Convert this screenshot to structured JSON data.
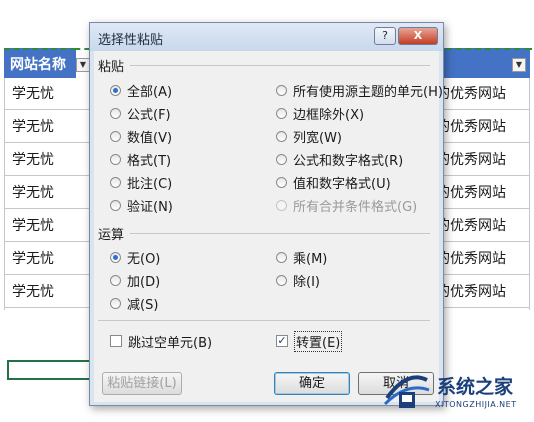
{
  "sheet": {
    "header_left": "网站名称",
    "rows_left": [
      "学无忧",
      "学无忧",
      "学无忧",
      "学无忧",
      "学无忧",
      "学无忧",
      "学无忧"
    ],
    "rows_right": [
      "的优秀网站",
      "的优秀网站",
      "的优秀网站",
      "的优秀网站",
      "的优秀网站",
      "的优秀网站",
      "的优秀网站"
    ],
    "header_color": "#4472c4"
  },
  "dialog": {
    "title": "选择性粘贴",
    "help_label": "?",
    "close_label": "X",
    "paste_section": "粘贴",
    "paste_options_left": [
      {
        "label": "全部(A)",
        "checked": true
      },
      {
        "label": "公式(F)",
        "checked": false
      },
      {
        "label": "数值(V)",
        "checked": false
      },
      {
        "label": "格式(T)",
        "checked": false
      },
      {
        "label": "批注(C)",
        "checked": false
      },
      {
        "label": "验证(N)",
        "checked": false
      }
    ],
    "paste_options_right": [
      {
        "label": "所有使用源主题的单元(H)",
        "checked": false,
        "disabled": false
      },
      {
        "label": "边框除外(X)",
        "checked": false,
        "disabled": false
      },
      {
        "label": "列宽(W)",
        "checked": false,
        "disabled": false
      },
      {
        "label": "公式和数字格式(R)",
        "checked": false,
        "disabled": false
      },
      {
        "label": "值和数字格式(U)",
        "checked": false,
        "disabled": false
      },
      {
        "label": "所有合并条件格式(G)",
        "checked": false,
        "disabled": true
      }
    ],
    "operation_section": "运算",
    "operation_options_left": [
      {
        "label": "无(O)",
        "checked": true
      },
      {
        "label": "加(D)",
        "checked": false
      },
      {
        "label": "减(S)",
        "checked": false
      }
    ],
    "operation_options_right": [
      {
        "label": "乘(M)",
        "checked": false
      },
      {
        "label": "除(I)",
        "checked": false
      }
    ],
    "skip_blanks_label": "跳过空单元(B)",
    "skip_blanks_checked": false,
    "transpose_label": "转置(E)",
    "transpose_checked": true,
    "paste_link_label": "粘贴链接(L)",
    "ok_label": "确定",
    "cancel_label": "取消"
  },
  "watermark": {
    "text": "系统之家",
    "url": "XITONGZHIJIA.NET"
  },
  "colors": {
    "radio_dot": "#2d6fd0",
    "dialog_frame": "#d9e4f1",
    "close_button": "#c43c24"
  }
}
